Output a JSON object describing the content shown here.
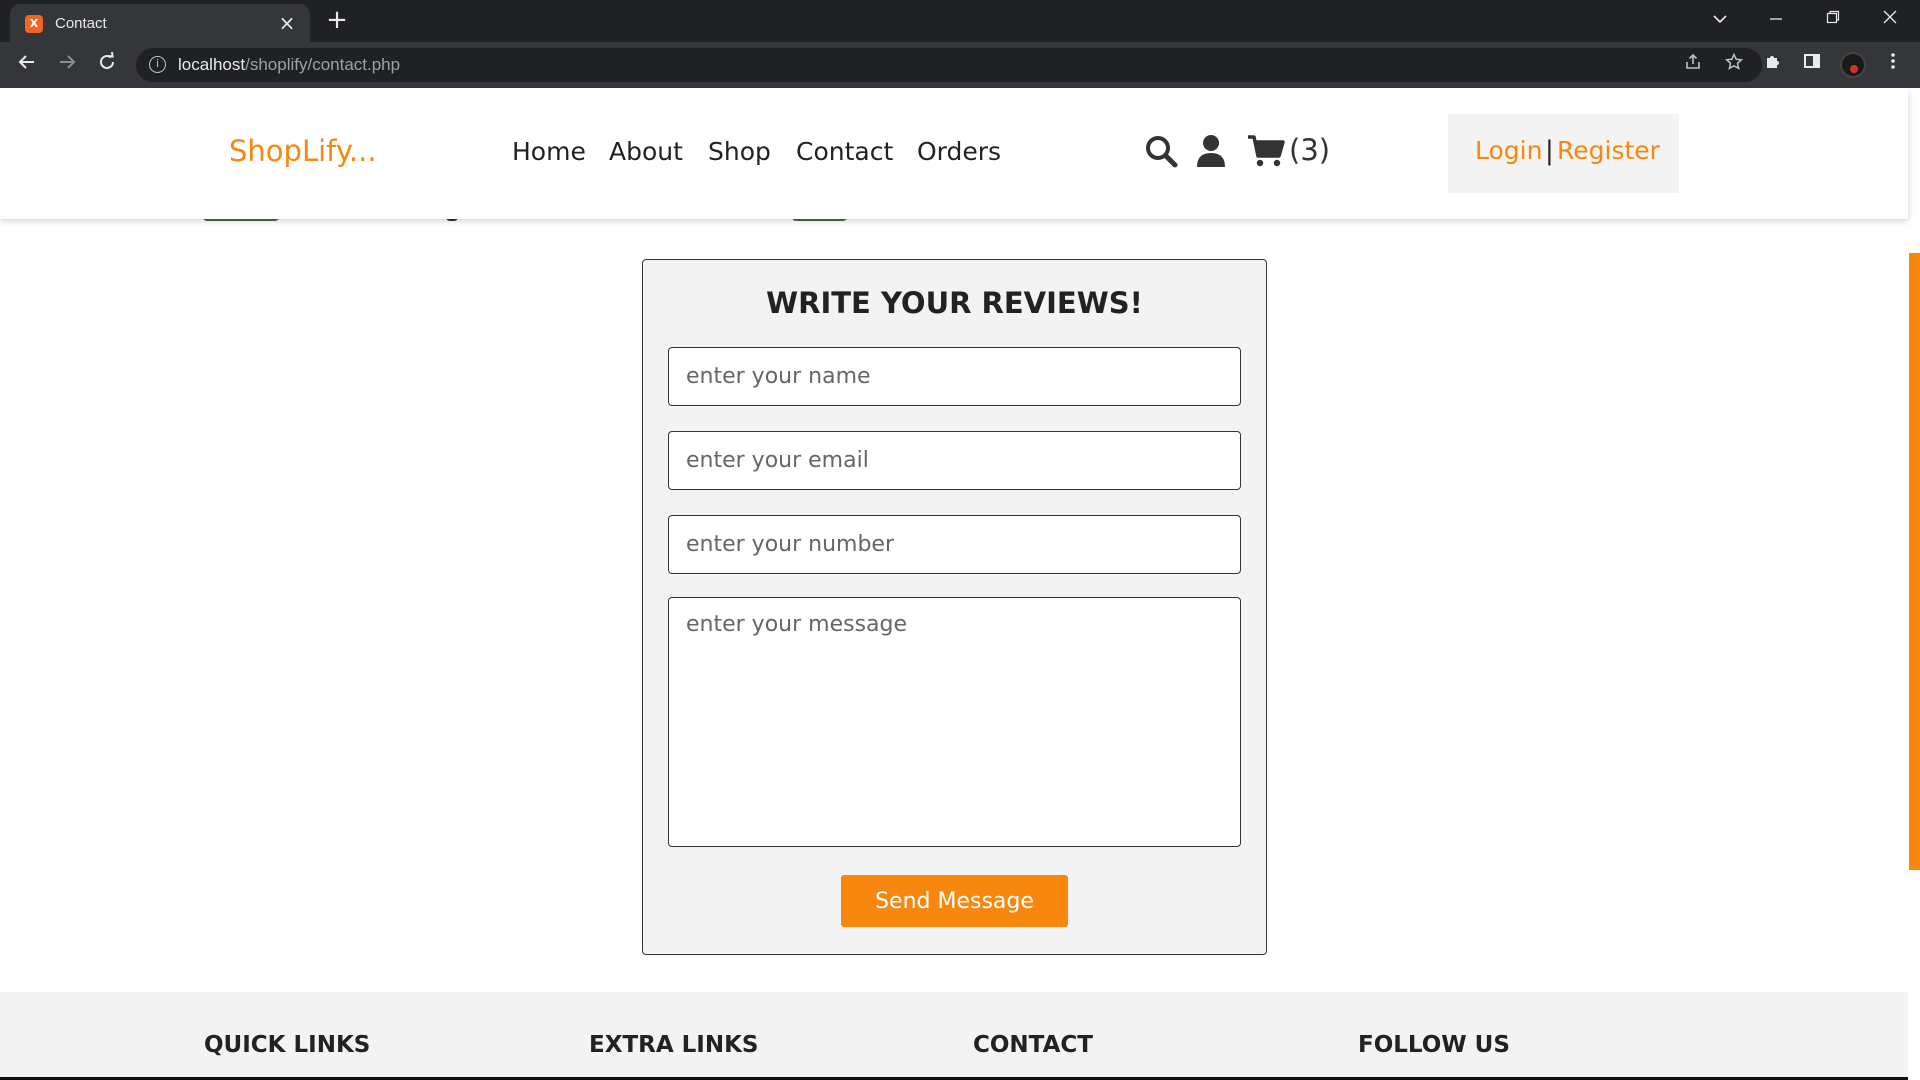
{
  "browser": {
    "tab_title": "Contact",
    "favicon_label": "X",
    "url_host": "localhost",
    "url_path": "/shoplify/contact.php"
  },
  "header": {
    "logo": "ShopLify...",
    "nav": [
      "Home",
      "About",
      "Shop",
      "Contact",
      "Orders"
    ],
    "cart_count": "(3)",
    "login": "Login",
    "separator": "|",
    "register": "Register"
  },
  "form": {
    "title": "WRITE YOUR REVIEWS!",
    "name_placeholder": "enter your name",
    "email_placeholder": "enter your email",
    "number_placeholder": "enter your number",
    "message_placeholder": "enter your message",
    "submit_label": "Send Message"
  },
  "footer": {
    "headings": [
      "QUICK LINKS",
      "EXTRA LINKS",
      "CONTACT",
      "FOLLOW US"
    ]
  },
  "colors": {
    "accent": "#f7870f",
    "text": "#222222",
    "panel": "#f3f3f3"
  }
}
